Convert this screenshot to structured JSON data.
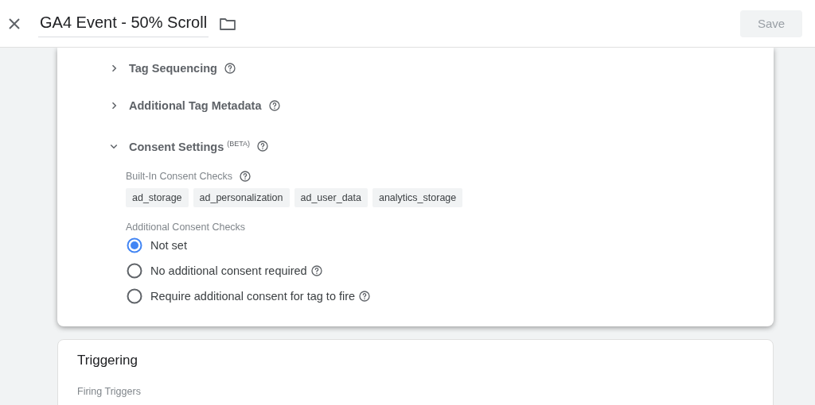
{
  "header": {
    "title": "GA4 Event - 50% Scroll",
    "save_button": {
      "label": "Save",
      "disabled": true
    }
  },
  "sections": [
    {
      "label": "Tag Sequencing",
      "expanded": false
    },
    {
      "label": "Additional Tag Metadata",
      "expanded": false
    },
    {
      "label": "Consent Settings $^{(BETA)}$",
      "expanded": true
    }
  ],
  "consent": {
    "built_in_label": "Built-In Consent Checks",
    "chips": [
      "ad_storage",
      "ad_personalization",
      "ad_user_data",
      "analytics_storage"
    ],
    "additional_label": "Additional Consent Checks",
    "options": [
      {
        "label": "Not set",
        "selected": true,
        "help": false
      },
      {
        "label": "No additional consent required",
        "selected": false,
        "help": true
      },
      {
        "label": "Require additional consent for tag to fire",
        "selected": false,
        "help": true
      }
    ]
  },
  "triggering": {
    "title": "Triggering",
    "subtitle": "Firing Triggers"
  }
}
